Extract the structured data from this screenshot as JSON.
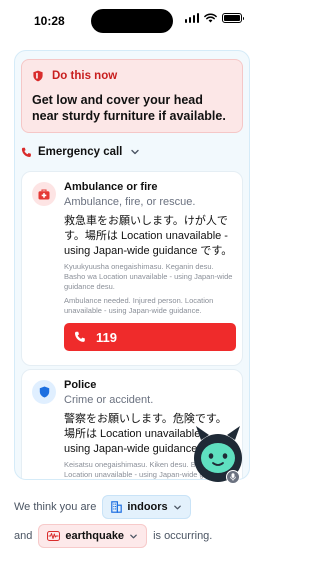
{
  "status_bar": {
    "time": "10:28"
  },
  "alert": {
    "title": "Do this now",
    "body": "Get low and cover your head near sturdy furniture if available.",
    "icon": "shield-alert-icon",
    "color": "#c81e1e"
  },
  "emergency_call": {
    "label": "Emergency call",
    "icon": "phone-icon"
  },
  "cards": [
    {
      "title": "Ambulance or fire",
      "subtitle": "Ambulance, fire, or rescue.",
      "japanese": "救急車をお願いします。けが人です。場所は Location unavailable - using Japan-wide guidance です。",
      "romaji": "Kyuukyuusha onegaishimasu. Keganin desu. Basho wa Location unavailable - using Japan-wide guidance desu.",
      "english": "Ambulance needed. Injured person. Location unavailable - using Japan-wide guidance.",
      "number": "119",
      "icon": "first-aid-kit-icon"
    },
    {
      "title": "Police",
      "subtitle": "Crime or accident.",
      "japanese": "警察をお願いします。危険です。場所は Location unavailable - using Japan-wide guidance です。",
      "romaji": "Keisatsu onegaishimasu. Kiken desu. Basho wa Location unavailable - using Japan-wide guidance desu.",
      "icon": "shield-icon"
    }
  ],
  "context": {
    "prefix": "We think you are",
    "location_value": "indoors",
    "connector": "and",
    "event_value": "earthquake",
    "suffix": "is occurring."
  },
  "colors": {
    "call_button": "#ef2b2b",
    "panel_bg": "#f2f9fd",
    "mascot": "#5fe0c0"
  }
}
